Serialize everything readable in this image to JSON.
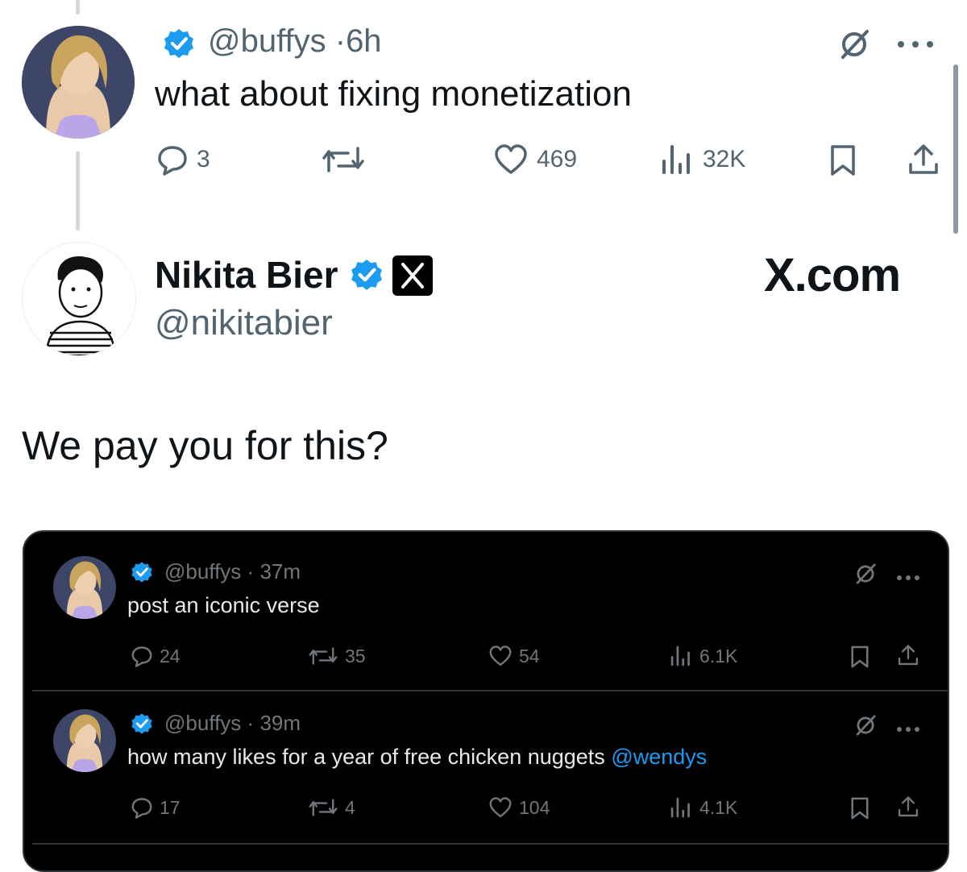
{
  "top_reply": {
    "handle": "@buffys",
    "time": "6h",
    "separator": "·",
    "text": "what about fixing monetization",
    "replies": "3",
    "likes": "469",
    "views": "32K",
    "icons": [
      "verified-badge-icon",
      "grok-icon",
      "more-icon",
      "reply-icon",
      "retweet-icon",
      "like-icon",
      "views-icon",
      "bookmark-icon",
      "share-icon"
    ]
  },
  "main_post": {
    "name": "Nikita Bier",
    "handle": "@nikitabier",
    "brand": "X.com",
    "text": "We pay you for this?"
  },
  "embedded": [
    {
      "handle": "@buffys",
      "time": "37m",
      "text": "post an iconic verse",
      "mention": "",
      "replies": "24",
      "retweets": "35",
      "likes": "54",
      "views": "6.1K"
    },
    {
      "handle": "@buffys",
      "time": "39m",
      "text": "how many likes for a year of free chicken nuggets",
      "mention": "@wendys",
      "replies": "17",
      "retweets": "4",
      "likes": "104",
      "views": "4.1K"
    }
  ],
  "colors": {
    "verified": "#1d9bf0",
    "muted": "#536471",
    "dark_bg": "#000000",
    "link": "#1d9bf0"
  }
}
